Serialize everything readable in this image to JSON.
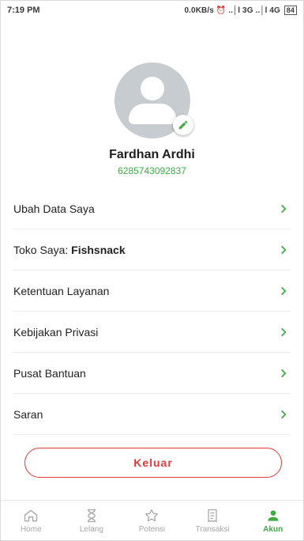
{
  "status_bar": {
    "time": "7:19 PM",
    "network": "0.0KB/s ⏰ ..│l 3G ..│l 4G",
    "battery": "84"
  },
  "profile": {
    "name": "Fardhan Ardhi",
    "phone": "6285743092837"
  },
  "menu": {
    "items": [
      {
        "label": "Ubah Data Saya"
      },
      {
        "label": "Toko Saya: ",
        "bold": "Fishsnack"
      },
      {
        "label": "Ketentuan Layanan"
      },
      {
        "label": "Kebijakan Privasi"
      },
      {
        "label": "Pusat Bantuan"
      },
      {
        "label": "Saran"
      }
    ]
  },
  "logout_label": "Keluar",
  "bottom_nav": {
    "items": [
      {
        "label": "Home",
        "icon": "home-icon"
      },
      {
        "label": "Lelang",
        "icon": "hourglass-icon"
      },
      {
        "label": "Potensi",
        "icon": "star-icon"
      },
      {
        "label": "Transaksi",
        "icon": "receipt-icon"
      },
      {
        "label": "Akun",
        "icon": "user-icon"
      }
    ],
    "active": "Akun"
  },
  "colors": {
    "accent": "#3cab44",
    "danger": "#e0393a",
    "inactive": "#a7a7a7"
  }
}
